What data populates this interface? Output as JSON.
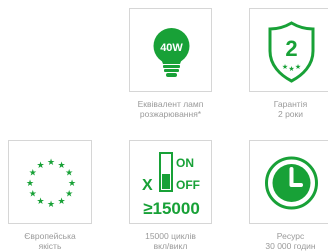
{
  "features": [
    {
      "id": "equivalent",
      "icon": "bulb-icon",
      "badge": "40W",
      "caption_line1": "Еквівалент ламп",
      "caption_line2": "розжарювання*"
    },
    {
      "id": "warranty",
      "icon": "shield-icon",
      "badge": "2",
      "caption_line1": "Гарантія",
      "caption_line2": "2 роки"
    },
    {
      "id": "eu",
      "icon": "eu-stars-icon",
      "caption_line1": "Європейська",
      "caption_line2": "якість"
    },
    {
      "id": "cycles",
      "icon": "switch-icon",
      "on_label": "ON",
      "off_label": "OFF",
      "x_label": "X",
      "count_label": "≥15000",
      "caption_line1": "15000 циклів",
      "caption_line2": "вкл/викл"
    },
    {
      "id": "lifetime",
      "icon": "clock-icon",
      "caption_line1": "Ресурс",
      "caption_line2": "30 000 годин"
    }
  ],
  "colors": {
    "accent": "#18a137",
    "border": "#d6d6d6",
    "caption": "#9a9a9a"
  }
}
